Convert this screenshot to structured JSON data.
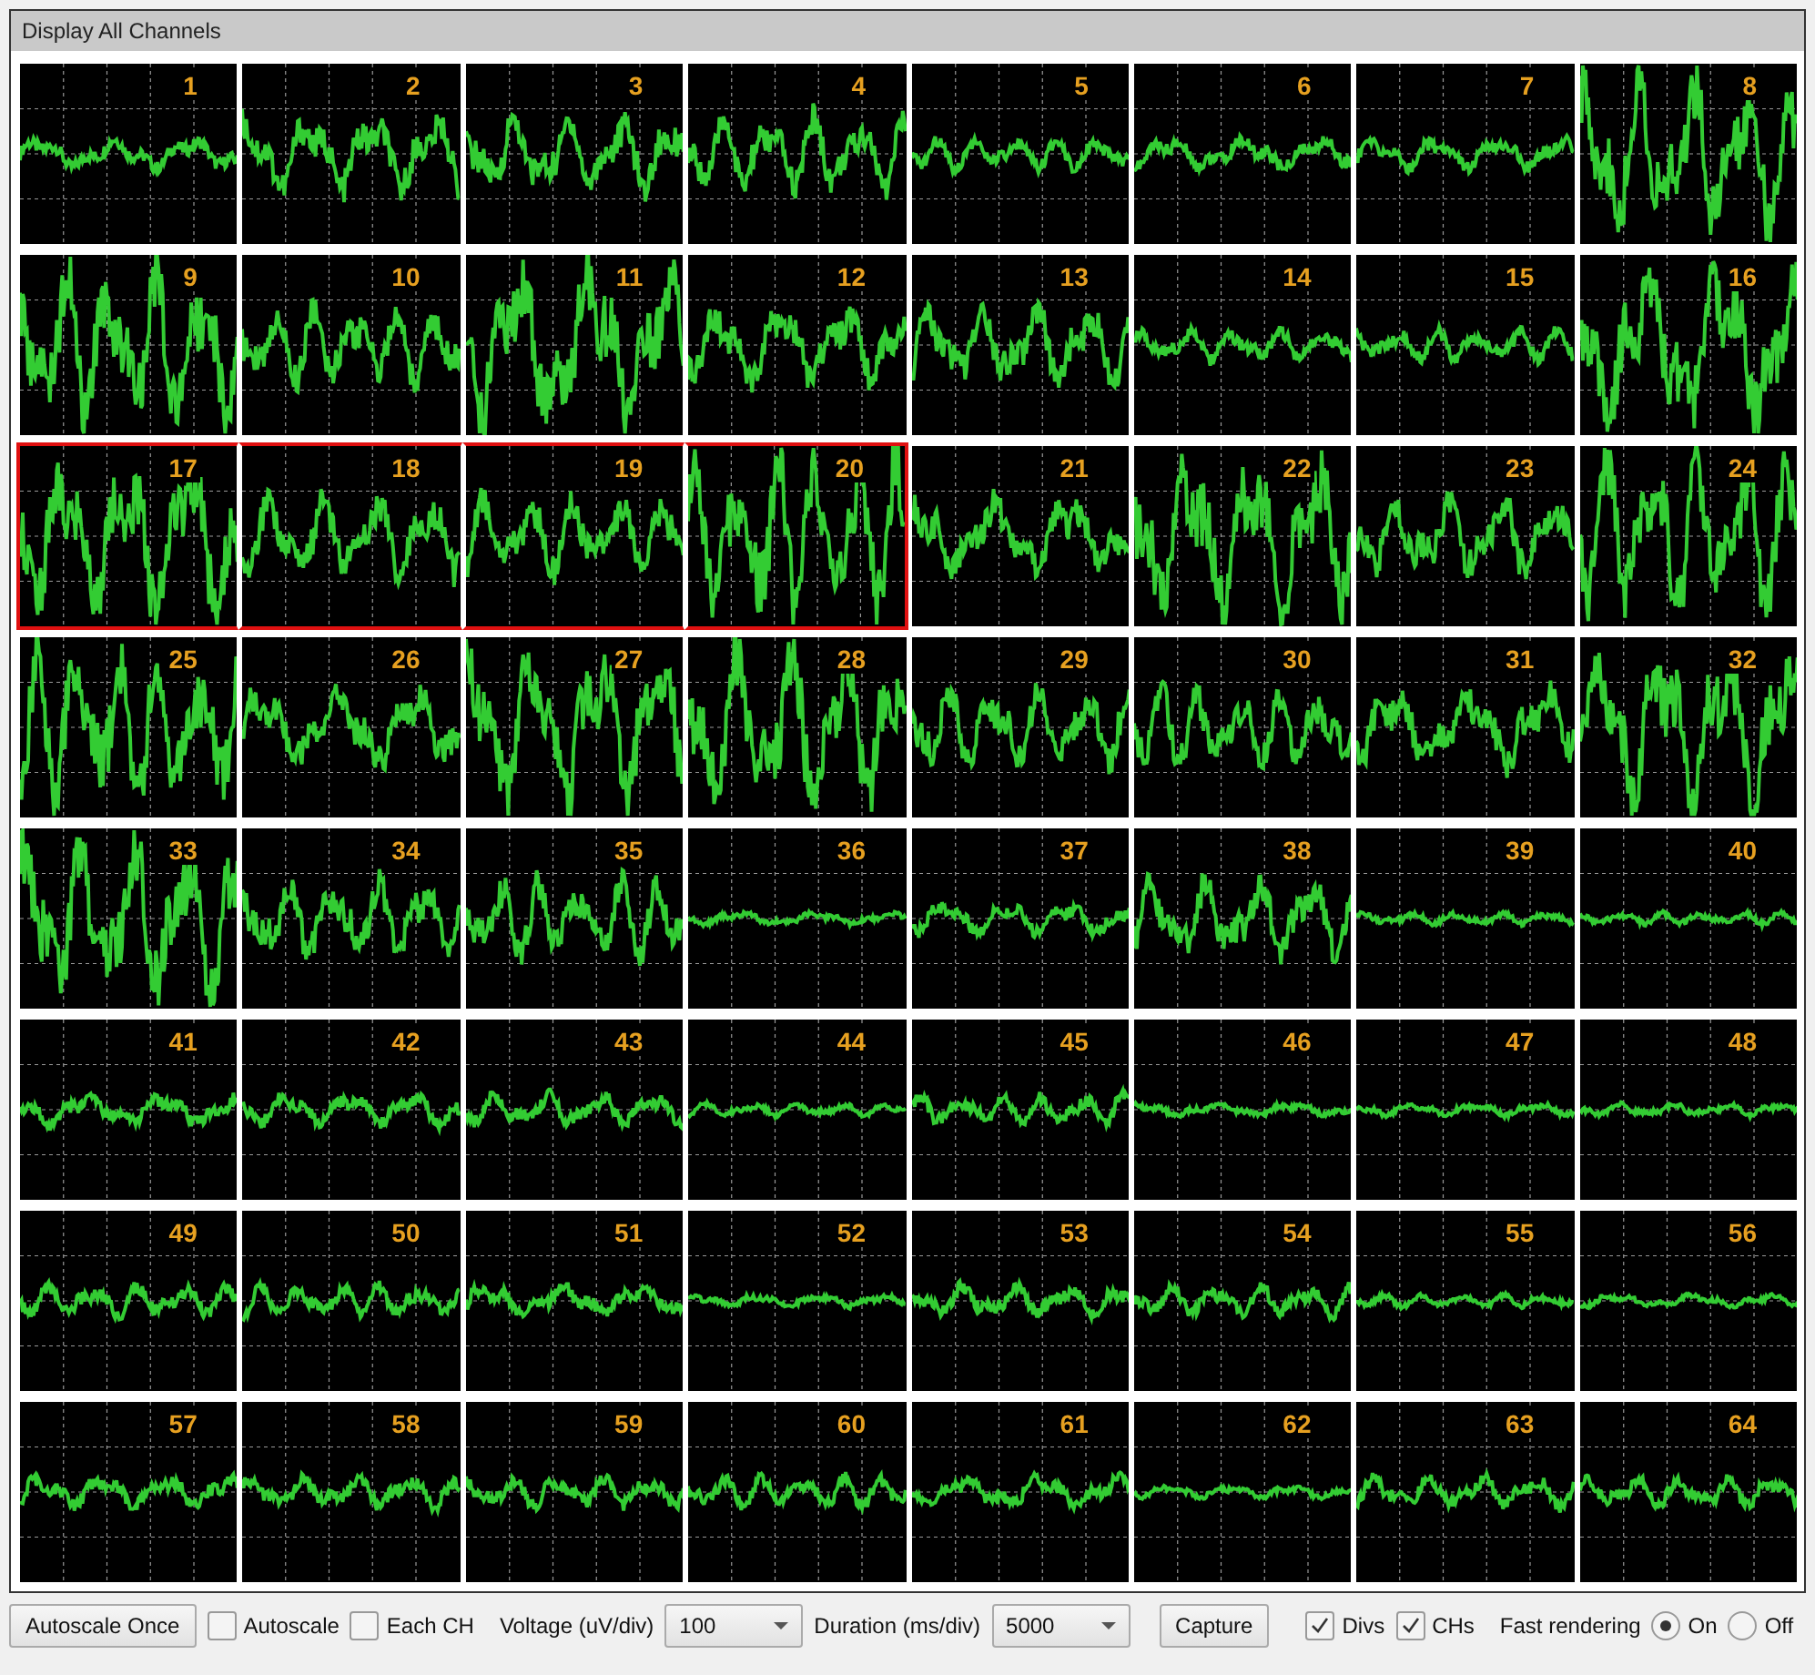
{
  "panel": {
    "title": "Display All Channels"
  },
  "channels": [
    {
      "label": "1",
      "kind": "low",
      "selected": false
    },
    {
      "label": "2",
      "kind": "medium",
      "selected": false
    },
    {
      "label": "3",
      "kind": "medium",
      "selected": false
    },
    {
      "label": "4",
      "kind": "medium",
      "selected": false
    },
    {
      "label": "5",
      "kind": "low",
      "selected": false
    },
    {
      "label": "6",
      "kind": "low",
      "selected": false
    },
    {
      "label": "7",
      "kind": "low",
      "selected": false
    },
    {
      "label": "8",
      "kind": "high",
      "selected": false
    },
    {
      "label": "9",
      "kind": "high",
      "selected": false
    },
    {
      "label": "10",
      "kind": "medium",
      "selected": false
    },
    {
      "label": "11",
      "kind": "high",
      "selected": false
    },
    {
      "label": "12",
      "kind": "medium",
      "selected": false
    },
    {
      "label": "13",
      "kind": "medium",
      "selected": false
    },
    {
      "label": "14",
      "kind": "low",
      "selected": false
    },
    {
      "label": "15",
      "kind": "low",
      "selected": false
    },
    {
      "label": "16",
      "kind": "high",
      "selected": false
    },
    {
      "label": "17",
      "kind": "high",
      "selected": true
    },
    {
      "label": "18",
      "kind": "medium",
      "selected": true
    },
    {
      "label": "19",
      "kind": "medium",
      "selected": true
    },
    {
      "label": "20",
      "kind": "high",
      "selected": true
    },
    {
      "label": "21",
      "kind": "medium",
      "selected": false
    },
    {
      "label": "22",
      "kind": "high",
      "selected": false
    },
    {
      "label": "23",
      "kind": "medium",
      "selected": false
    },
    {
      "label": "24",
      "kind": "high",
      "selected": false
    },
    {
      "label": "25",
      "kind": "high",
      "selected": false
    },
    {
      "label": "26",
      "kind": "medium",
      "selected": false
    },
    {
      "label": "27",
      "kind": "high",
      "selected": false
    },
    {
      "label": "28",
      "kind": "high",
      "selected": false
    },
    {
      "label": "29",
      "kind": "medium",
      "selected": false
    },
    {
      "label": "30",
      "kind": "medium",
      "selected": false
    },
    {
      "label": "31",
      "kind": "medium",
      "selected": false
    },
    {
      "label": "32",
      "kind": "high",
      "selected": false
    },
    {
      "label": "33",
      "kind": "high",
      "selected": false
    },
    {
      "label": "34",
      "kind": "medium",
      "selected": false
    },
    {
      "label": "35",
      "kind": "medium",
      "selected": false
    },
    {
      "label": "36",
      "kind": "flat",
      "selected": false
    },
    {
      "label": "37",
      "kind": "low",
      "selected": false
    },
    {
      "label": "38",
      "kind": "medium",
      "selected": false
    },
    {
      "label": "39",
      "kind": "flat",
      "selected": false
    },
    {
      "label": "40",
      "kind": "flat",
      "selected": false
    },
    {
      "label": "41",
      "kind": "low",
      "selected": false
    },
    {
      "label": "42",
      "kind": "low",
      "selected": false
    },
    {
      "label": "43",
      "kind": "low",
      "selected": false
    },
    {
      "label": "44",
      "kind": "flat",
      "selected": false
    },
    {
      "label": "45",
      "kind": "low",
      "selected": false
    },
    {
      "label": "46",
      "kind": "flat",
      "selected": false
    },
    {
      "label": "47",
      "kind": "flat",
      "selected": false
    },
    {
      "label": "48",
      "kind": "flat",
      "selected": false
    },
    {
      "label": "49",
      "kind": "low",
      "selected": false
    },
    {
      "label": "50",
      "kind": "low",
      "selected": false
    },
    {
      "label": "51",
      "kind": "low",
      "selected": false
    },
    {
      "label": "52",
      "kind": "flat",
      "selected": false
    },
    {
      "label": "53",
      "kind": "low",
      "selected": false
    },
    {
      "label": "54",
      "kind": "low",
      "selected": false
    },
    {
      "label": "55",
      "kind": "flat",
      "selected": false
    },
    {
      "label": "56",
      "kind": "flat",
      "selected": false
    },
    {
      "label": "57",
      "kind": "low",
      "selected": false
    },
    {
      "label": "58",
      "kind": "low",
      "selected": false
    },
    {
      "label": "59",
      "kind": "low",
      "selected": false
    },
    {
      "label": "60",
      "kind": "low",
      "selected": false
    },
    {
      "label": "61",
      "kind": "low",
      "selected": false
    },
    {
      "label": "62",
      "kind": "flat",
      "selected": false
    },
    {
      "label": "63",
      "kind": "low",
      "selected": false
    },
    {
      "label": "64",
      "kind": "low",
      "selected": false
    }
  ],
  "toolbar": {
    "autoscale_once": "Autoscale Once",
    "autoscale": {
      "label": "Autoscale",
      "checked": false
    },
    "each_ch": {
      "label": "Each CH",
      "checked": false
    },
    "voltage": {
      "label": "Voltage (uV/div)",
      "value": "100"
    },
    "duration": {
      "label": "Duration (ms/div)",
      "value": "5000"
    },
    "capture": "Capture",
    "divs": {
      "label": "Divs",
      "checked": true
    },
    "chs": {
      "label": "CHs",
      "checked": true
    },
    "fast_rendering": {
      "label": "Fast rendering",
      "options": [
        {
          "label": "On",
          "selected": true
        },
        {
          "label": "Off",
          "selected": false
        }
      ]
    }
  }
}
